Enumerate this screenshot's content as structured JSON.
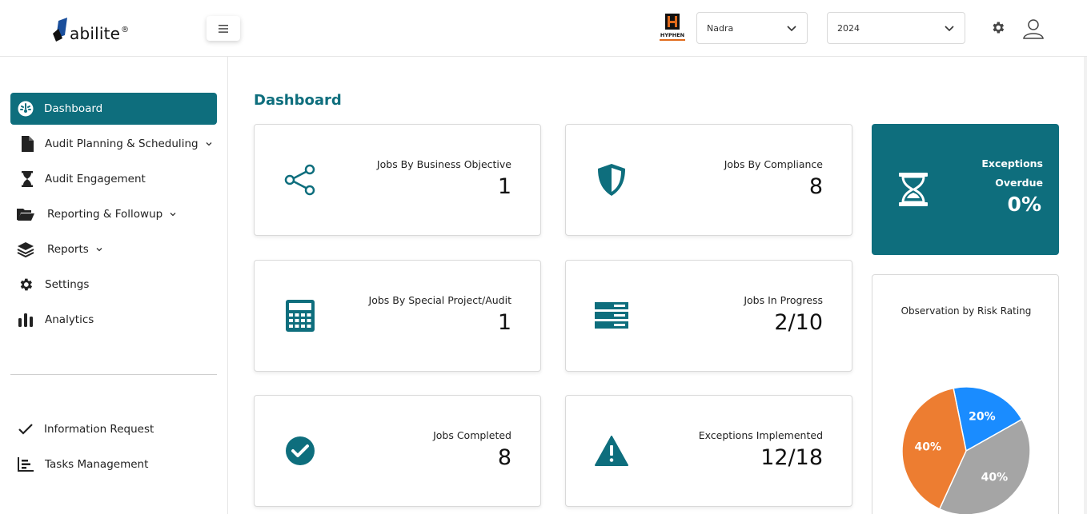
{
  "header": {
    "logo_text": "abilite",
    "logo_reg": "®",
    "menu_icon": "hamburger-icon",
    "company_logo_text": "HYPHEN",
    "org_select": "Nadra",
    "year_select": "2024"
  },
  "sidebar": {
    "items": [
      {
        "label": "Dashboard",
        "icon": "dashboard-gauge-icon"
      },
      {
        "label": "Audit Planning & Scheduling",
        "icon": "document-icon"
      },
      {
        "label": "Audit Engagement",
        "icon": "hourglass-icon"
      },
      {
        "label": "Reporting & Followup",
        "icon": "folder-open-icon"
      },
      {
        "label": "Reports",
        "icon": "layers-icon"
      },
      {
        "label": "Settings",
        "icon": "gear-icon"
      },
      {
        "label": "Analytics",
        "icon": "bar-chart-icon"
      }
    ],
    "bottom_items": [
      {
        "label": "Information Request",
        "icon": "checkmark-icon"
      },
      {
        "label": "Tasks Management",
        "icon": "tasks-chart-icon"
      }
    ]
  },
  "main": {
    "title": "Dashboard",
    "cards": [
      {
        "label": "Jobs By Business Objective",
        "value": "1",
        "icon": "share-icon"
      },
      {
        "label": "Jobs By Compliance",
        "value": "8",
        "icon": "shield-icon"
      },
      {
        "label": "Jobs By Special Project/Audit",
        "value": "1",
        "icon": "calculator-icon"
      },
      {
        "label": "Jobs In Progress",
        "value": "2/10",
        "icon": "server-icon"
      },
      {
        "label": "Jobs Completed",
        "value": "8",
        "icon": "check-circle-icon"
      },
      {
        "label": "Exceptions Implemented",
        "value": "12/18",
        "icon": "warning-icon"
      }
    ],
    "exceptions": {
      "label1": "Exceptions",
      "label2": "Overdue",
      "value": "0%",
      "icon": "hourglass-icon"
    },
    "colors": {
      "primary": "#0e6e7d",
      "orange": "#ed7d31",
      "blue": "#1a8cff",
      "gray": "#a5a5a5"
    }
  },
  "chart_data": {
    "type": "pie",
    "title": "Observation by Risk Rating",
    "slices": [
      {
        "label": "20%",
        "value": 20,
        "color": "#1a8cff"
      },
      {
        "label": "40%",
        "value": 40,
        "color": "#a5a5a5"
      },
      {
        "label": "40%",
        "value": 40,
        "color": "#ed7d31"
      }
    ]
  }
}
